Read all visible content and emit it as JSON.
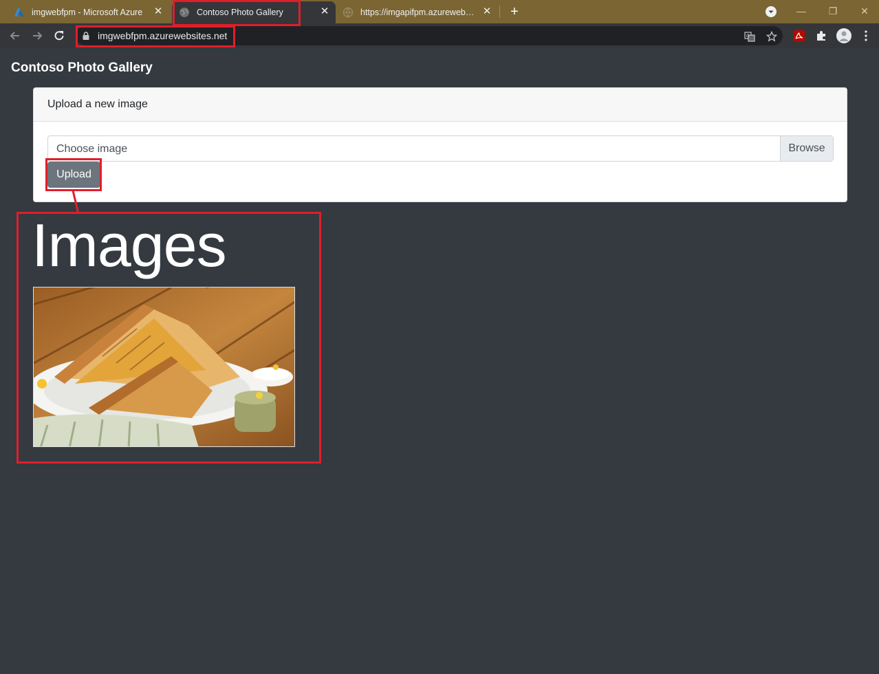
{
  "browser": {
    "tabs": [
      {
        "title": "imgwebfpm - Microsoft Azure",
        "icon": "azure-icon",
        "active": false
      },
      {
        "title": "Contoso Photo Gallery",
        "icon": "globe-icon",
        "active": true
      },
      {
        "title": "https://imgapifpm.azurewebsites.net",
        "icon": "globe-icon",
        "active": false
      }
    ],
    "new_tab": "+",
    "url": "imgwebfpm.azurewebsites.net",
    "colors": {
      "frame": "#7a6533",
      "toolbar": "#35363a",
      "highlight": "#e01e2b"
    }
  },
  "page": {
    "site_title": "Contoso Photo Gallery",
    "upload_card": {
      "header": "Upload a new image",
      "file_placeholder": "Choose image",
      "browse_label": "Browse",
      "upload_label": "Upload"
    },
    "images_heading": "Images",
    "gallery": [
      {
        "alt": "grilled sandwich on a plate with dips",
        "icon": "photo-thumbnail"
      }
    ],
    "colors": {
      "background": "#343a40",
      "button": "#6c757d"
    }
  }
}
